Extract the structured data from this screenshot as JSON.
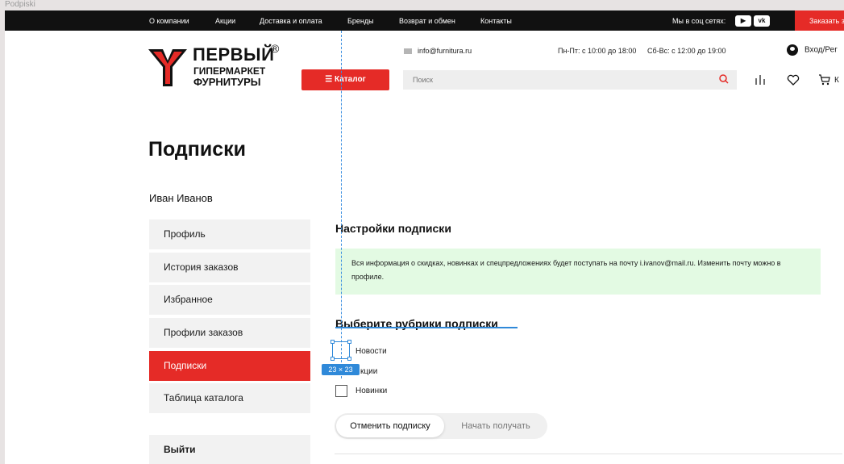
{
  "frame_label": "Podpiski",
  "topbar": {
    "links": [
      "О компании",
      "Акции",
      "Доставка и оплата",
      "Бренды",
      "Возврат и обмен",
      "Контакты"
    ],
    "social_label": "Мы в соц сетях:",
    "social_icons": [
      "youtube-icon",
      "vk-icon"
    ],
    "order_button": "Заказать з"
  },
  "header": {
    "logo": {
      "line1": "ПЕРВЫЙ",
      "line2": "ГИПЕРМАРКЕТ",
      "line3": "ФУРНИТУРЫ"
    },
    "email": "info@furnitura.ru",
    "hours_weekdays": "Пн-Пт: с 10:00 до 18:00",
    "hours_weekend": "Сб-Вс: с 12:00 до 19:00",
    "login_label": "Вход/Рег",
    "catalog_button": "☰ Каталог",
    "search_placeholder": "Поиск",
    "cart_label": "К"
  },
  "page": {
    "title": "Подписки",
    "user_name": "Иван Иванов"
  },
  "sidebar": {
    "items": [
      {
        "label": "Профиль",
        "active": false
      },
      {
        "label": "История заказов",
        "active": false
      },
      {
        "label": "Избранное",
        "active": false
      },
      {
        "label": "Профили заказов",
        "active": false
      },
      {
        "label": "Подписки",
        "active": true
      },
      {
        "label": "Таблица каталога",
        "active": false
      }
    ],
    "logout": "Выйти"
  },
  "subscription": {
    "settings_title": "Настройки подписки",
    "info_text": "Вся информация о скидках, новинках и спецпредложениях будет поступать на почту i.ivanov@mail.ru. Изменить почту можно в профиле.",
    "choose_title": "Выберите рубрики подписки",
    "options": [
      {
        "label": "Новости",
        "checked": false
      },
      {
        "label": "кции",
        "checked": false
      },
      {
        "label": "Новинки",
        "checked": false
      }
    ],
    "unsubscribe_button": "Отменить подписку",
    "start_button": "Начать получать"
  },
  "editor_overlay": {
    "size_badge": "23 × 23"
  },
  "colors": {
    "accent": "#e52b27",
    "topbar": "#111111",
    "info_bg": "#e3fae3",
    "selection": "#2f89d9"
  }
}
